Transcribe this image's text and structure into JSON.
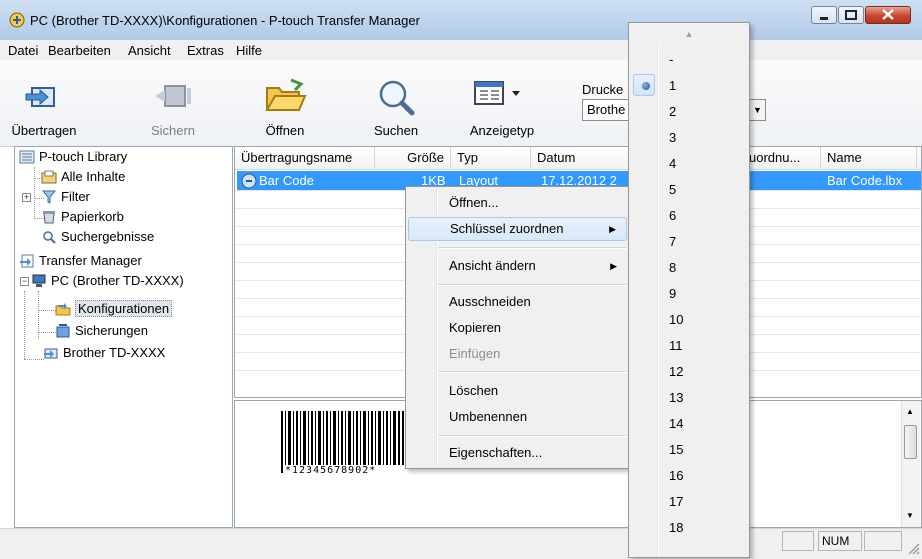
{
  "window": {
    "title": "PC (Brother TD-XXXX)\\Konfigurationen - P-touch Transfer Manager"
  },
  "menu": [
    "Datei",
    "Bearbeiten",
    "Ansicht",
    "Extras",
    "Hilfe"
  ],
  "toolbar": {
    "transfer": "Übertragen",
    "backup": "Sichern",
    "open": "Öffnen",
    "search": "Suchen",
    "viewtype": "Anzeigetyp",
    "printer_label": "Drucke",
    "printer_value": "Brothe"
  },
  "tree": {
    "library": "P-touch Library",
    "all": "Alle Inhalte",
    "filter": "Filter",
    "trash": "Papierkorb",
    "searchresults": "Suchergebnisse",
    "tm": "Transfer Manager",
    "pc": "PC (Brother TD-XXXX)",
    "configs": "Konfigurationen",
    "backups": "Sicherungen",
    "device": "Brother TD-XXXX"
  },
  "list": {
    "columns": [
      "Übertragungsname",
      "Größe",
      "Typ",
      "Datum",
      "uordnu...",
      "Name"
    ],
    "row": {
      "name": "Bar Code",
      "size": "1KB",
      "type": "Layout",
      "date": "17.12.2012 2",
      "file": "Bar Code.lbx"
    }
  },
  "preview": {
    "barcode_text": "*12345678902*"
  },
  "context_menu": {
    "open": "Öffnen...",
    "assign_key": "Schlüssel zuordnen",
    "change_view": "Ansicht ändern",
    "cut": "Ausschneiden",
    "copy": "Kopieren",
    "paste": "Einfügen",
    "delete": "Löschen",
    "rename": "Umbenennen",
    "properties": "Eigenschaften..."
  },
  "key_menu": {
    "items": [
      "-",
      "1",
      "2",
      "3",
      "4",
      "5",
      "6",
      "7",
      "8",
      "9",
      "10",
      "11",
      "12",
      "13",
      "14",
      "15",
      "16",
      "17",
      "18"
    ],
    "selected": "1"
  },
  "status": {
    "num": "NUM"
  }
}
